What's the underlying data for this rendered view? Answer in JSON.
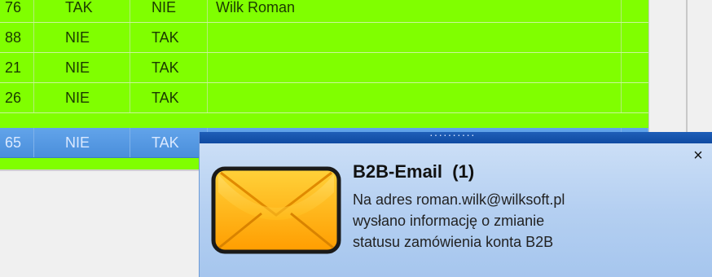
{
  "grid": {
    "rows": [
      {
        "id": "76",
        "col_a": "TAK",
        "col_b": "NIE",
        "name": "Wilk Roman",
        "selected": false
      },
      {
        "id": "88",
        "col_a": "NIE",
        "col_b": "TAK",
        "name": "",
        "selected": false
      },
      {
        "id": "21",
        "col_a": "NIE",
        "col_b": "TAK",
        "name": "",
        "selected": false
      },
      {
        "id": "26",
        "col_a": "NIE",
        "col_b": "TAK",
        "name": "",
        "selected": false
      },
      {
        "id": "65",
        "col_a": "NIE",
        "col_b": "TAK",
        "name": "",
        "selected": true
      }
    ]
  },
  "notification": {
    "title": "B2B-Email  (1)",
    "lines": [
      "Na adres roman.wilk@wilksoft.pl",
      "wysłano informację o zmianie",
      "statusu zamówienia konta B2B"
    ],
    "close_symbol": "×",
    "grip_symbol": "··········",
    "icon": "envelope-icon"
  },
  "colors": {
    "row_green": "#80ff00",
    "row_selected": "#4a8edb",
    "notification_bar": "#0f4aa1",
    "envelope_fill": "#ffb400"
  }
}
